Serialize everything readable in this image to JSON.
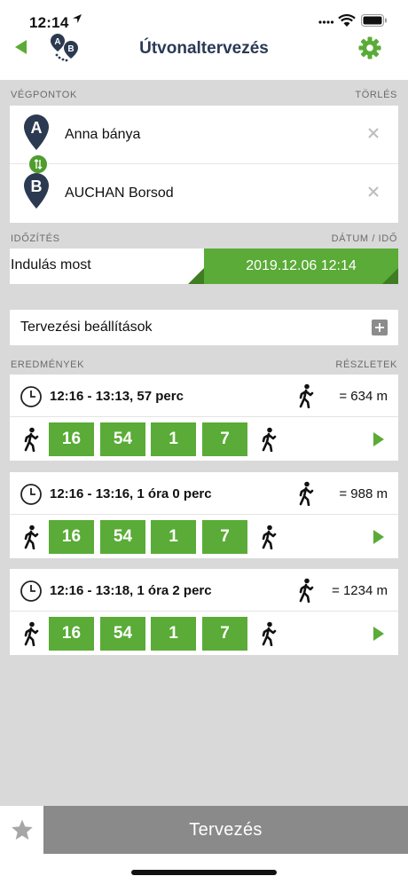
{
  "status": {
    "time": "12:14"
  },
  "header": {
    "title": "Útvonaltervezés",
    "logo_a": "A",
    "logo_b": "B"
  },
  "endpoints": {
    "heading": "VÉGPONTOK",
    "clear": "TÖRLÉS",
    "from": {
      "letter": "A",
      "name": "Anna bánya"
    },
    "to": {
      "letter": "B",
      "name": "AUCHAN Borsod"
    }
  },
  "timing": {
    "heading": "IDŐZÍTÉS",
    "right_heading": "DÁTUM / IDŐ",
    "departure": "Indulás most",
    "datetime": "2019.12.06 12:14"
  },
  "settings": {
    "label": "Tervezési beállítások"
  },
  "results": {
    "heading": "EREDMÉNYEK",
    "details": "RÉSZLETEK",
    "routes": [
      {
        "summary": "12:16 - 13:13,  57 perc",
        "distance": "= 634 m",
        "lines": [
          "16",
          "54",
          "1",
          "7"
        ]
      },
      {
        "summary": "12:16 - 13:16,  1 óra 0 perc",
        "distance": "= 988 m",
        "lines": [
          "16",
          "54",
          "1",
          "7"
        ]
      },
      {
        "summary": "12:16 - 13:18,  1 óra 2 perc",
        "distance": "= 1234 m",
        "lines": [
          "16",
          "54",
          "1",
          "7"
        ]
      }
    ]
  },
  "footer": {
    "plan_button": "Tervezés"
  },
  "colors": {
    "accent_green": "#5aab37",
    "title_blue": "#2a3a55",
    "pin_dark": "#2b3a50"
  },
  "icons": [
    "back-icon",
    "app-logo-icon",
    "gear-icon",
    "pin-a-icon",
    "pin-b-icon",
    "swap-icon",
    "clear-icon",
    "plus-icon",
    "clock-icon",
    "walk-icon",
    "play-icon",
    "star-icon"
  ]
}
